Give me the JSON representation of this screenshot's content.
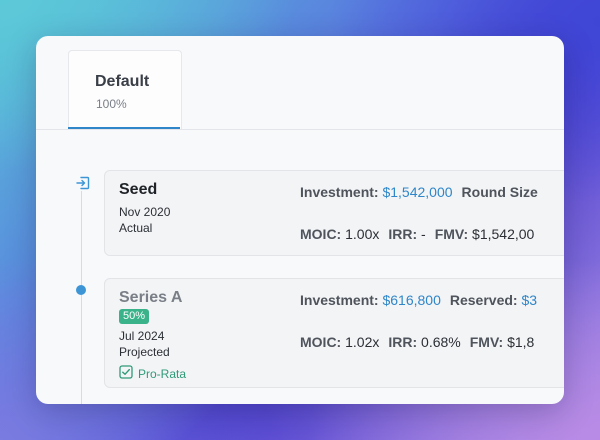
{
  "tab": {
    "title": "Default",
    "subtitle": "100%"
  },
  "rounds": [
    {
      "name": "Seed",
      "date": "Nov 2020",
      "status": "Actual",
      "investment_label": "Investment:",
      "investment_value": "$1,542,000",
      "second_label": "Round Size",
      "moic_label": "MOIC:",
      "moic_value": "1.00x",
      "irr_label": "IRR:",
      "irr_value": "-",
      "fmv_label": "FMV:",
      "fmv_value": "$1,542,00"
    },
    {
      "name": "Series A",
      "badge": "50%",
      "date": "Jul 2024",
      "status": "Projected",
      "prorata": "Pro-Rata",
      "investment_label": "Investment:",
      "investment_value": "$616,800",
      "second_label": "Reserved:",
      "second_value": "$3",
      "moic_label": "MOIC:",
      "moic_value": "1.02x",
      "irr_label": "IRR:",
      "irr_value": "0.68%",
      "fmv_label": "FMV:",
      "fmv_value": "$1,8"
    }
  ],
  "colors": {
    "accent": "#2f86c8",
    "badge": "#3bb38a",
    "prorata": "#2f9a78"
  },
  "icons": {
    "enter": "enter-icon",
    "check": "checkbox-checked-icon"
  }
}
